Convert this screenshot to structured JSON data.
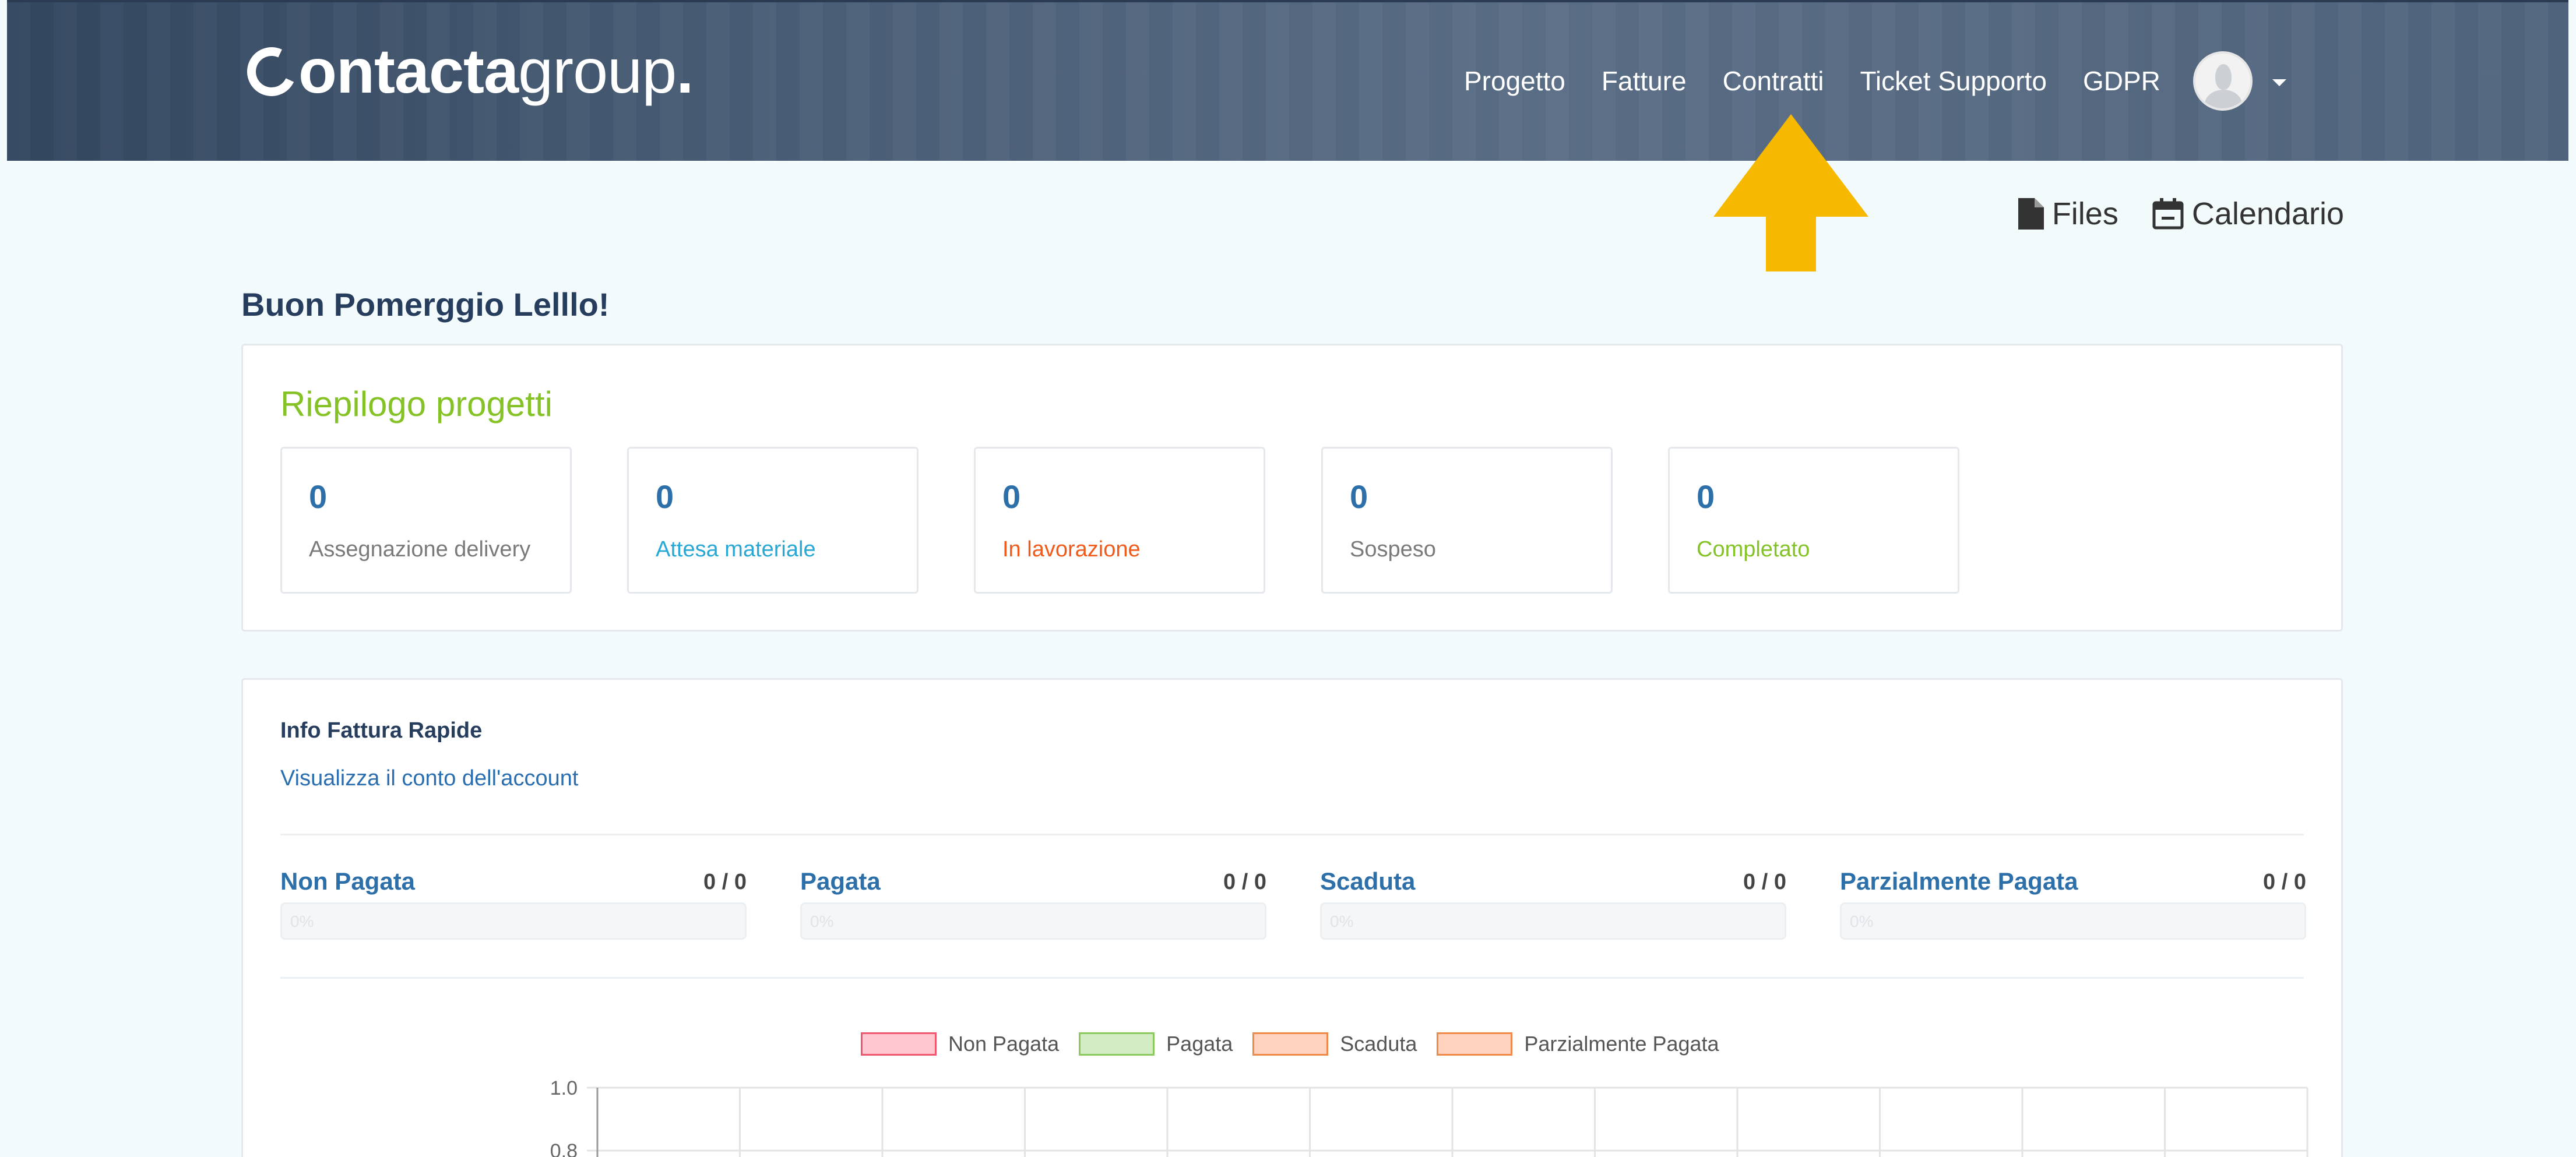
{
  "header": {
    "logo": {
      "bold": "ontacta",
      "light": "group",
      "dot": "."
    },
    "nav": [
      "Progetto",
      "Fatture",
      "Contratti",
      "Ticket Supporto",
      "GDPR"
    ]
  },
  "tools": {
    "files": "Files",
    "calendar": "Calendario"
  },
  "greeting": "Buon Pomerggio Lelllo!",
  "summary": {
    "title": "Riepilogo progetti",
    "statuses": [
      {
        "count": "0",
        "label": "Assegnazione delivery",
        "color": "#7a7a7a"
      },
      {
        "count": "0",
        "label": "Attesa materiale",
        "color": "#29a8d6"
      },
      {
        "count": "0",
        "label": "In lavorazione",
        "color": "#f05a1a"
      },
      {
        "count": "0",
        "label": "Sospeso",
        "color": "#7a7a7a"
      },
      {
        "count": "0",
        "label": "Completato",
        "color": "#84c225"
      }
    ]
  },
  "invoice": {
    "title": "Info Fattura Rapide",
    "account_link": "Visualizza il conto dell'account",
    "stats": [
      {
        "name": "Non Pagata",
        "count": "0 / 0",
        "pct": "0%",
        "progress": 0
      },
      {
        "name": "Pagata",
        "count": "0 / 0",
        "pct": "0%",
        "progress": 0
      },
      {
        "name": "Scaduta",
        "count": "0 / 0",
        "pct": "0%",
        "progress": 0
      },
      {
        "name": "Parzialmente Pagata",
        "count": "0 / 0",
        "pct": "0%",
        "progress": 0
      }
    ]
  },
  "chart_data": {
    "type": "bar",
    "series": [
      {
        "name": "Non Pagata",
        "values": [],
        "fill": "#ffc7cf",
        "stroke": "#f0576e"
      },
      {
        "name": "Pagata",
        "values": [],
        "fill": "#d4ecc4",
        "stroke": "#8cc95f"
      },
      {
        "name": "Scaduta",
        "values": [],
        "fill": "#ffd3bd",
        "stroke": "#f08a4b"
      },
      {
        "name": "Parzialmente Pagata",
        "values": [],
        "fill": "#ffd3bd",
        "stroke": "#f08a4b"
      }
    ],
    "yticks": [
      "1.0",
      "0.8"
    ],
    "ylim": [
      0,
      1.0
    ],
    "grid": true,
    "legend": "top-center"
  },
  "colors": {
    "accent_yellow": "#f7b900",
    "link_blue": "#2d6fa8",
    "green": "#84c225"
  }
}
